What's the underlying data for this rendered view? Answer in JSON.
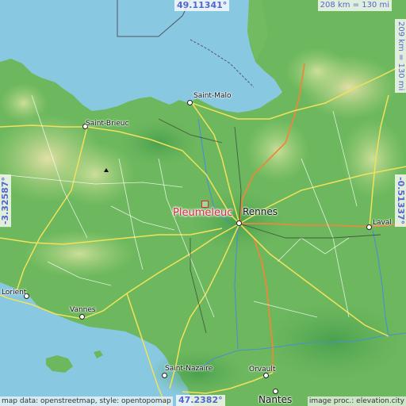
{
  "map": {
    "place_name": "Pleumeleuc",
    "coords": {
      "north": "49.11341°",
      "south": "47.2382°",
      "west": "-3.32587°",
      "east": "-0.51337°"
    },
    "scale": {
      "horizontal": "208 km = 130 mi",
      "vertical": "209 km = 130 mi"
    },
    "cities": {
      "saint_malo": "Saint-Malo",
      "saint_brieuc": "Saint-Brieuc",
      "rennes": "Rennes",
      "laval": "Laval",
      "lorient": "Lorient",
      "vannes": "Vannes",
      "saint_nazaire": "Saint-Nazaire",
      "orvault": "Orvault",
      "nantes": "Nantes"
    },
    "attribution_left": "map data: openstreetmap, style: opentopomap",
    "attribution_right": "image proc.: elevation.city",
    "colors": {
      "sea": "#88c8e0",
      "land": "#7fc06a",
      "marker": "#d8283a",
      "coord_text": "#5566cc"
    }
  }
}
